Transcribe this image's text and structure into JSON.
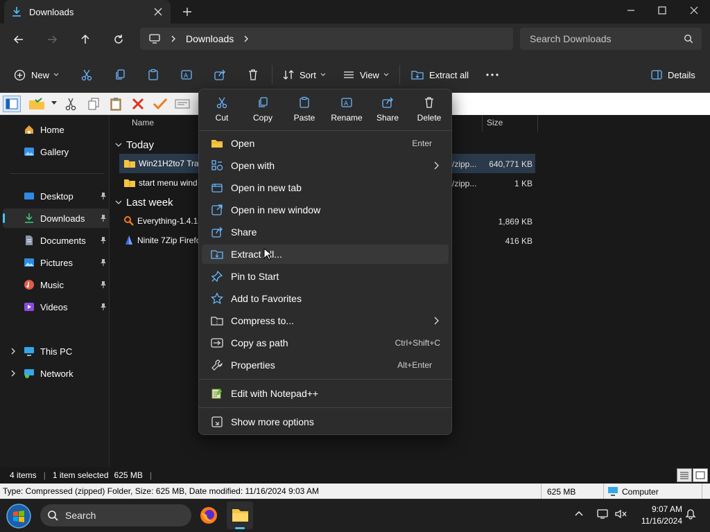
{
  "window": {
    "tab_title": "Downloads"
  },
  "address": {
    "crumb": "Downloads",
    "search_placeholder": "Search Downloads"
  },
  "commandbar": {
    "new_label": "New",
    "sort_label": "Sort",
    "view_label": "View",
    "extract_all_label": "Extract all",
    "details_label": "Details"
  },
  "sidebar": {
    "items": [
      {
        "label": "Home"
      },
      {
        "label": "Gallery"
      },
      {
        "label": "Desktop"
      },
      {
        "label": "Downloads"
      },
      {
        "label": "Documents"
      },
      {
        "label": "Pictures"
      },
      {
        "label": "Music"
      },
      {
        "label": "Videos"
      },
      {
        "label": "This PC"
      },
      {
        "label": "Network"
      }
    ]
  },
  "content": {
    "columns": {
      "name": "Name",
      "size": "Size"
    },
    "groups": [
      {
        "label": "Today"
      },
      {
        "label": "Last week"
      }
    ],
    "rows": [
      {
        "name": "Win21H2to7 Tran",
        "type": "/zipp...",
        "size": "640,771 KB"
      },
      {
        "name": "start menu wind",
        "type": "/zipp...",
        "size": "1 KB"
      },
      {
        "name": "Everything-1.4.1.",
        "type": "",
        "size": "1,869 KB"
      },
      {
        "name": "Ninite 7Zip Firefo",
        "type": "",
        "size": "416 KB"
      }
    ]
  },
  "context_menu": {
    "quick_actions": [
      {
        "label": "Cut"
      },
      {
        "label": "Copy"
      },
      {
        "label": "Paste"
      },
      {
        "label": "Rename"
      },
      {
        "label": "Share"
      },
      {
        "label": "Delete"
      }
    ],
    "items": [
      {
        "label": "Open",
        "shortcut": "Enter"
      },
      {
        "label": "Open with",
        "shortcut": ""
      },
      {
        "label": "Open in new tab",
        "shortcut": ""
      },
      {
        "label": "Open in new window",
        "shortcut": ""
      },
      {
        "label": "Share",
        "shortcut": ""
      },
      {
        "label": "Extract All...",
        "shortcut": ""
      },
      {
        "label": "Pin to Start",
        "shortcut": ""
      },
      {
        "label": "Add to Favorites",
        "shortcut": ""
      },
      {
        "label": "Compress to...",
        "shortcut": ""
      },
      {
        "label": "Copy as path",
        "shortcut": "Ctrl+Shift+C"
      },
      {
        "label": "Properties",
        "shortcut": "Alt+Enter"
      },
      {
        "label": "Edit with Notepad++",
        "shortcut": ""
      },
      {
        "label": "Show more options",
        "shortcut": ""
      }
    ]
  },
  "status": {
    "items_count": "4 items",
    "selected": "1 item selected",
    "selected_size": "625 MB"
  },
  "infobar": {
    "details": "Type: Compressed (zipped) Folder, Size: 625 MB, Date modified: 11/16/2024 9:03 AM",
    "size": "625 MB",
    "location": "Computer"
  },
  "taskbar": {
    "search_label": "Search",
    "time": "9:07 AM",
    "date": "11/16/2024"
  },
  "colors": {
    "accent": "#4cc2ff",
    "folder": "#f6c343"
  }
}
